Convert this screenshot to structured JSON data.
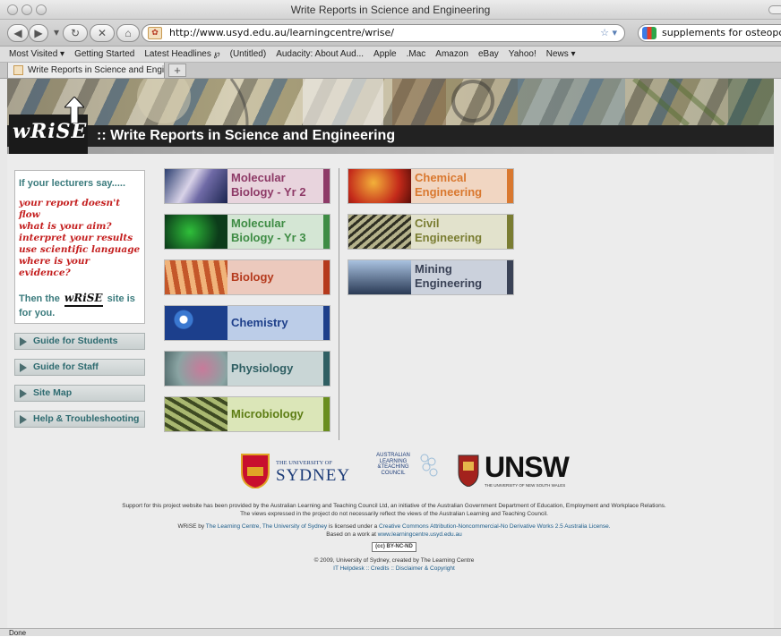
{
  "window": {
    "title": "Write Reports in Science and Engineering"
  },
  "toolbar": {
    "url": "http://www.usyd.edu.au/learningcentre/wrise/",
    "search_value": "supplements for osteoporosis",
    "back_icon": "back-arrow-icon",
    "forward_icon": "forward-arrow-icon"
  },
  "bookmarks": [
    "Most Visited ▾",
    "Getting Started",
    "Latest Headlines ℘",
    "(Untitled)",
    "Audacity: About Aud...",
    "Apple",
    ".Mac",
    "Amazon",
    "eBay",
    "Yahoo!",
    "News ▾"
  ],
  "tab": {
    "label": "Write Reports in Science and Engi...",
    "new_tab": "+"
  },
  "banner": {
    "logo": "wRiSE",
    "title": ":: Write Reports in Science and Engineering"
  },
  "promo": {
    "heading": "If your lecturers say.....",
    "quotes": [
      "your report doesn't flow",
      "what is your aim?",
      "interpret your results",
      "use scientific language",
      "where is your evidence?"
    ],
    "then_prefix": "Then the",
    "then_logo": "wRiSE",
    "then_suffix": "site is",
    "then_end": "for you."
  },
  "nav": [
    {
      "label": "Guide for Students"
    },
    {
      "label": "Guide for Staff"
    },
    {
      "label": "Site Map"
    },
    {
      "label": "Help & Troubleshooting"
    }
  ],
  "subjects_left": [
    {
      "line1": "Molecular",
      "line2": "Biology - Yr 2",
      "bg": "#e8d4dd",
      "bar": "#8e3a67",
      "color": "#8e3a67"
    },
    {
      "line1": "Molecular",
      "line2": "Biology - Yr 3",
      "bg": "#d4e6d4",
      "bar": "#3e8c44",
      "color": "#3e8c44"
    },
    {
      "line1": "Biology",
      "line2": "",
      "bg": "#ecc9bd",
      "bar": "#b5391c",
      "color": "#b5391c"
    },
    {
      "line1": "Chemistry",
      "line2": "",
      "bg": "#bccde8",
      "bar": "#1e3f8a",
      "color": "#1e3f8a"
    },
    {
      "line1": "Physiology",
      "line2": "",
      "bg": "#c9d6d6",
      "bar": "#2f5f63",
      "color": "#2f5f63"
    },
    {
      "line1": "Microbiology",
      "line2": "",
      "bg": "#dbe6b8",
      "bar": "#6a8e1e",
      "color": "#5d7d14"
    }
  ],
  "subjects_right": [
    {
      "line1": "Chemical",
      "line2": "Engineering",
      "bg": "#f1d6c2",
      "bar": "#d9782f",
      "color": "#d9782f"
    },
    {
      "line1": "Civil",
      "line2": "Engineering",
      "bg": "#e2e2cc",
      "bar": "#7a7d32",
      "color": "#7a7d32"
    },
    {
      "line1": "Mining",
      "line2": "Engineering",
      "bg": "#cbd1dc",
      "bar": "#3a4256",
      "color": "#3a4256"
    }
  ],
  "footer": {
    "sydney_small": "THE UNIVERSITY OF",
    "sydney_big": "SYDNEY",
    "altc_lines": [
      "AUSTRALIAN",
      "LEARNING",
      "&TEACHING",
      "COUNCIL"
    ],
    "unsw_big": "UNSW",
    "unsw_small": "THE UNIVERSITY OF NEW SOUTH WALES",
    "support_1": "Support for this project website has been provided by the Australian Learning and Teaching Council Ltd, an initiative of the Australian Government Department of Education, Employment and Workplace Relations.",
    "support_2": "The views expressed in the project do not necessarily reflect the views of the Australian Learning and Teaching Council.",
    "license_pre": "WRiSE by",
    "license_by": "The Learning Centre, The University of Sydney",
    "license_mid": "is licensed under a",
    "license_link": "Creative Commons Attribution-Noncommercial-No Derivative Works 2.5 Australia License.",
    "based_pre": "Based on a work at",
    "based_link": "www.learningcentre.usyd.edu.au",
    "cc_badge": "(cc) BY-NC-ND",
    "copyright": "© 2009, University of Sydney, created by The Learning Centre",
    "links": "IT Helpdesk :: Credits :: Disclaimer & Copyright"
  },
  "status": {
    "text": "Done"
  }
}
